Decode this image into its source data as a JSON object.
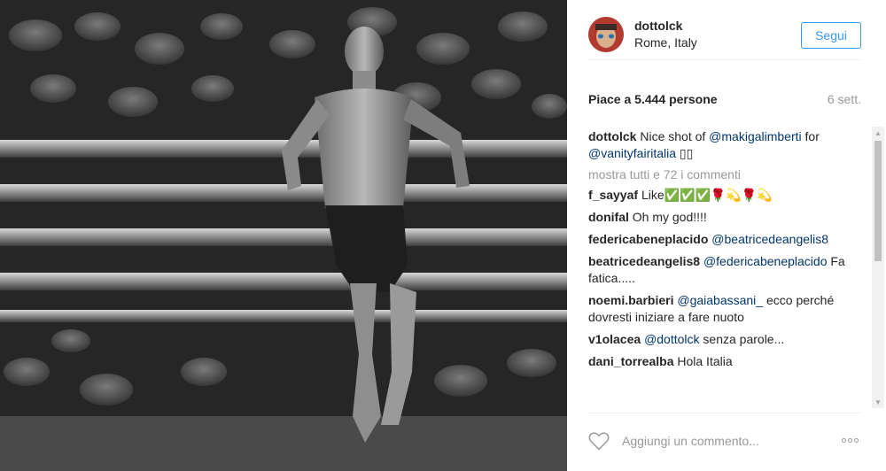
{
  "post": {
    "username": "dottolck",
    "location": "Rome, Italy",
    "follow_label": "Segui",
    "likes": "Piace a 5.444 persone",
    "time": "6 sett.",
    "caption": {
      "author": "dottolck",
      "text_before": "Nice shot of ",
      "mention1": "@makigalimberti",
      "text_mid": " for ",
      "mention2": "@vanityfairitalia",
      "text_after": " ▯▯"
    },
    "view_all_comments": "mostra tutti e 72 i commenti",
    "comments": [
      {
        "author": "f_sayyaf",
        "mention": "",
        "text": "Like✅✅✅🌹💫🌹💫"
      },
      {
        "author": "donifal",
        "mention": "",
        "text": "Oh my god!!!!"
      },
      {
        "author": "federicabeneplacido",
        "mention": "@beatricedeangelis8",
        "text": ""
      },
      {
        "author": "beatricedeangelis8",
        "mention": "@federicabeneplacido",
        "text": " Fa fatica....."
      },
      {
        "author": "noemi.barbieri",
        "mention": "@gaiabassani_",
        "text": " ecco perché dovresti iniziare a fare nuoto"
      },
      {
        "author": "v1olacea",
        "mention": "@dottolck",
        "text": " senza parole..."
      },
      {
        "author": "dani_torrealba",
        "mention": "",
        "text": "Hola Italia"
      }
    ],
    "comment_placeholder": "Aggiungi un commento...",
    "accent_color": "#3897f0"
  }
}
